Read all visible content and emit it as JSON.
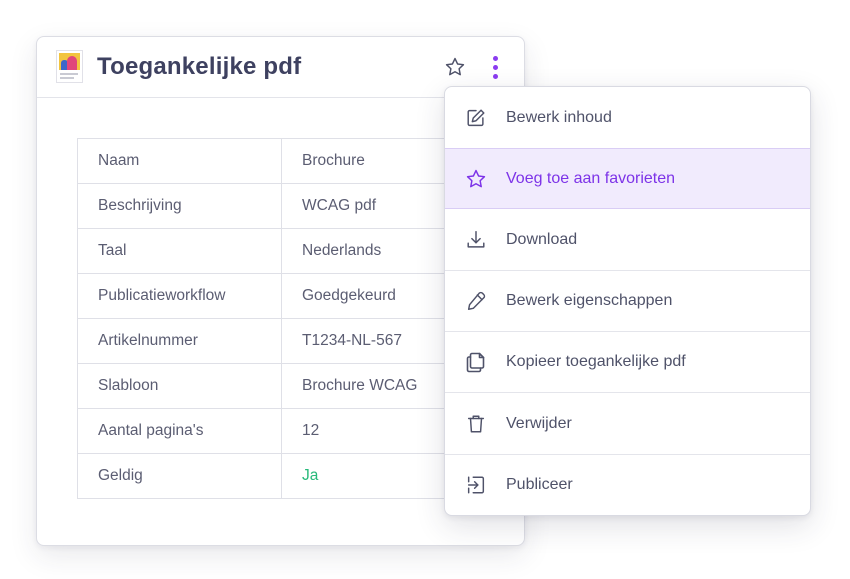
{
  "card": {
    "title": "Toegankelijke pdf",
    "icons": {
      "document": "pdf-thumbnail-icon",
      "favorite": "star-outline-icon",
      "menu": "kebab-menu-icon"
    },
    "properties": [
      {
        "label": "Naam",
        "value": "Brochure"
      },
      {
        "label": "Beschrijving",
        "value": "WCAG pdf"
      },
      {
        "label": "Taal",
        "value": "Nederlands"
      },
      {
        "label": "Publicatieworkflow",
        "value": "Goedgekeurd"
      },
      {
        "label": "Artikelnummer",
        "value": "T1234-NL-567"
      },
      {
        "label": "Slabloon",
        "value": "Brochure WCAG"
      },
      {
        "label": "Aantal pagina's",
        "value": "12"
      },
      {
        "label": "Geldig",
        "value": "Ja",
        "status": "success"
      }
    ]
  },
  "menu": {
    "items": [
      {
        "label": "Bewerk inhoud",
        "icon": "edit-icon"
      },
      {
        "label": "Voeg toe aan favorieten",
        "icon": "star-icon",
        "active": true
      },
      {
        "label": "Download",
        "icon": "download-icon"
      },
      {
        "label": "Bewerk eigenschappen",
        "icon": "pen-icon"
      },
      {
        "label": "Kopieer toegankelijke pdf",
        "icon": "copy-icon"
      },
      {
        "label": "Verwijder",
        "icon": "trash-icon"
      },
      {
        "label": "Publiceer",
        "icon": "publish-icon"
      }
    ]
  },
  "colors": {
    "accent": "#8b3cf0",
    "active_bg": "#f1ebfd",
    "success": "#27b97a",
    "title": "#3e4160",
    "text": "#5b5d72"
  }
}
